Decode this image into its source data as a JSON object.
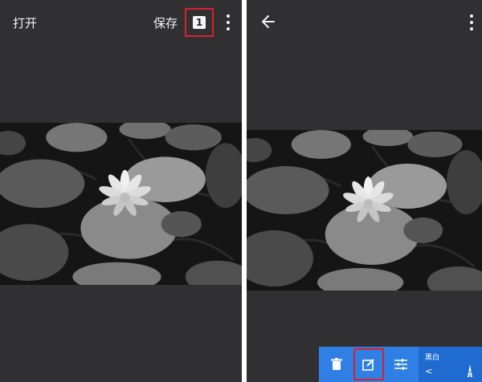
{
  "left_screen": {
    "open_label": "打开",
    "save_label": "保存",
    "count_badge": "1",
    "menu_icon": "more-vert-icon"
  },
  "right_screen": {
    "back_icon": "arrow-back-icon",
    "menu_icon": "more-vert-icon",
    "toolbar": {
      "delete_icon": "trash-icon",
      "edit_icon": "edit-icon",
      "adjust_icon": "tune-icon"
    },
    "filter": {
      "label": "黑白",
      "prev": "<",
      "tower_icon": "tower-icon"
    }
  },
  "colors": {
    "background": "#303032",
    "toolbar_blue": "#2f7fe4",
    "highlight_red": "#d8222d"
  }
}
